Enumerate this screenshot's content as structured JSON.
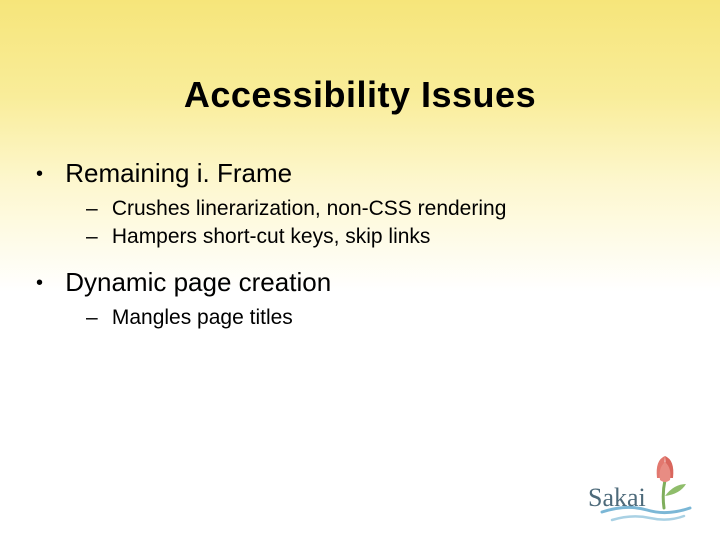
{
  "title": "Accessibility Issues",
  "bullets": [
    {
      "text": "Remaining i. Frame",
      "sub": [
        "Crushes linerarization, non-CSS rendering",
        "Hampers short-cut keys, skip links"
      ]
    },
    {
      "text": "Dynamic page creation",
      "sub": [
        "Mangles page titles"
      ]
    }
  ],
  "logo_text": "Sakai"
}
